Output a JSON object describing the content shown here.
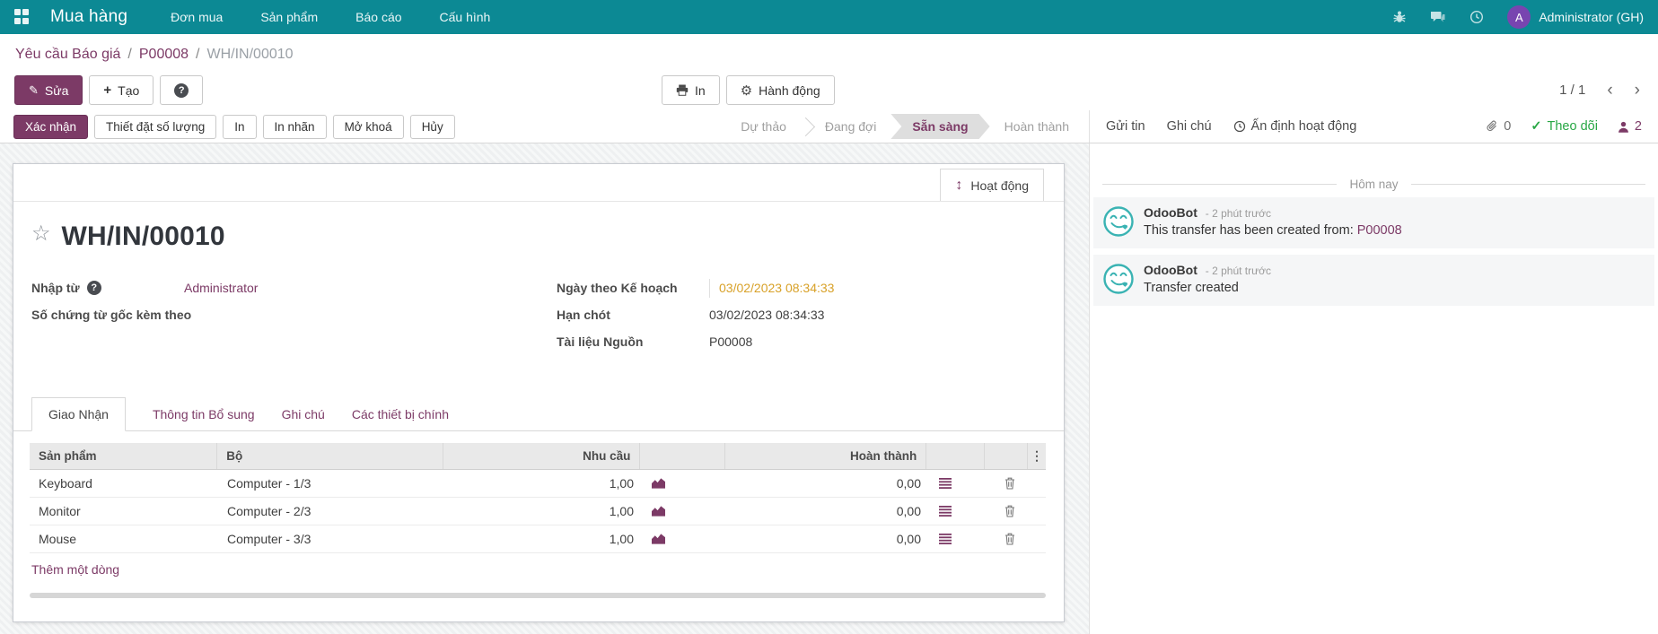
{
  "colors": {
    "navbar_teal": "#0c8994",
    "primary_purple": "#7c3a66",
    "avatar_purple": "#7845b0",
    "date_highlight": "#d8a128",
    "success_green": "#28a745"
  },
  "icons": {
    "pencil": "✎",
    "plus": "+",
    "question": "?",
    "gear": "⚙",
    "star": "☆",
    "updown": "↕",
    "kebab": "⋮",
    "check": "✓",
    "chevron_left": "‹",
    "chevron_right": "›"
  },
  "navbar": {
    "brand": "Mua hàng",
    "menus": [
      "Đơn mua",
      "Sản phẩm",
      "Báo cáo",
      "Cấu hình"
    ],
    "avatar_letter": "A",
    "user": "Administrator (GH)"
  },
  "breadcrumb": {
    "parent1": "Yêu cầu Báo giá",
    "parent2": "P00008",
    "separator": "/",
    "current": "WH/IN/00010"
  },
  "actions": {
    "edit": "Sửa",
    "create": "Tạo",
    "print": "In",
    "action": "Hành động",
    "pager": "1 / 1"
  },
  "statusbar": {
    "confirm": "Xác nhận",
    "buttons": [
      "Thiết đặt số lượng",
      "In",
      "In nhãn",
      "Mở khoá",
      "Hủy"
    ],
    "steps": [
      "Dự thảo",
      "Đang đợi",
      "Sẵn sàng",
      "Hoàn thành"
    ],
    "active_step": "Sẵn sàng"
  },
  "chatter": {
    "send": "Gửi tin",
    "log": "Ghi chú",
    "activity": "Ấn định hoạt động",
    "attach_count": "0",
    "follow": "Theo dõi",
    "follower_count": "2",
    "date_divider": "Hôm nay",
    "messages": [
      {
        "author": "OdooBot",
        "time": "- 2 phút trước",
        "text": "This transfer has been created from: ",
        "link": "P00008"
      },
      {
        "author": "OdooBot",
        "time": "- 2 phút trước",
        "text": "Transfer created",
        "link": ""
      }
    ]
  },
  "form": {
    "activity_button": "Hoạt động",
    "title": "WH/IN/00010",
    "fields_left": [
      {
        "label": "Nhập từ",
        "value": "Administrator"
      },
      {
        "label": "Số chứng từ gốc kèm theo",
        "value": ""
      }
    ],
    "fields_right": [
      {
        "label": "Ngày theo Kế hoạch",
        "value": "03/02/2023 08:34:33"
      },
      {
        "label": "Hạn chót",
        "value": "03/02/2023 08:34:33"
      },
      {
        "label": "Tài liệu Nguồn",
        "value": "P00008"
      }
    ],
    "tabs": [
      "Giao Nhận",
      "Thông tin Bổ sung",
      "Ghi chú",
      "Các thiết bị chính"
    ],
    "table": {
      "headers": [
        "Sản phẩm",
        "Bộ",
        "Nhu cầu",
        "",
        "Hoàn thành",
        ""
      ],
      "rows": [
        {
          "product": "Keyboard",
          "bo": "Computer - 1/3",
          "demand": "1,00",
          "done": "0,00"
        },
        {
          "product": "Monitor",
          "bo": "Computer - 2/3",
          "demand": "1,00",
          "done": "0,00"
        },
        {
          "product": "Mouse",
          "bo": "Computer - 3/3",
          "demand": "1,00",
          "done": "0,00"
        }
      ]
    },
    "add_line": "Thêm một dòng"
  }
}
